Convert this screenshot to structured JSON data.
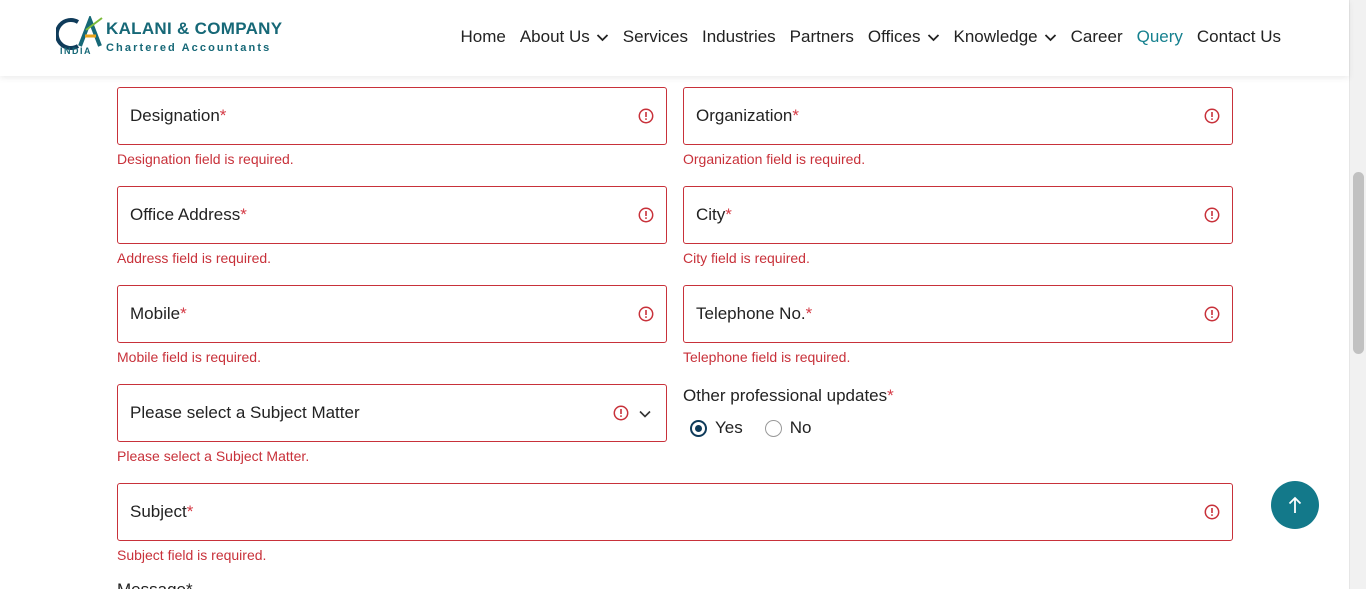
{
  "header": {
    "logo": {
      "name": "KALANI & COMPANY",
      "sub": "Chartered Accountants",
      "india": "INDIA",
      "mark": "CA"
    },
    "nav": [
      {
        "label": "Home"
      },
      {
        "label": "About Us"
      },
      {
        "label": "Services"
      },
      {
        "label": "Industries"
      },
      {
        "label": "Partners"
      },
      {
        "label": "Offices"
      },
      {
        "label": "Knowledge"
      },
      {
        "label": "Career"
      },
      {
        "label": "Query"
      },
      {
        "label": "Contact Us"
      }
    ],
    "active_nav": "Query"
  },
  "form": {
    "designation": {
      "label": "Designation",
      "required_mark": "*",
      "error": "Designation field is required."
    },
    "organization": {
      "label": "Organization",
      "required_mark": "*",
      "error": "Organization field is required."
    },
    "office_address": {
      "label": "Office Address",
      "required_mark": "*",
      "error": "Address field is required."
    },
    "city": {
      "label": "City",
      "required_mark": "*",
      "error": "City field is required."
    },
    "mobile": {
      "label": "Mobile",
      "required_mark": "*",
      "error": "Mobile field is required."
    },
    "telephone": {
      "label": "Telephone No.",
      "required_mark": "*",
      "error": "Telephone field is required."
    },
    "subject_matter": {
      "selected": "Please select a Subject Matter",
      "error": "Please select a Subject Matter."
    },
    "updates": {
      "label": "Other professional updates",
      "required_mark": "*",
      "options": [
        {
          "label": "Yes",
          "checked": true
        },
        {
          "label": "No",
          "checked": false
        }
      ]
    },
    "subject": {
      "label": "Subject",
      "required_mark": "*",
      "error": "Subject field is required."
    },
    "message_partial": "Message*"
  },
  "colors": {
    "brand": "#166877",
    "accent": "#16818f",
    "error": "#c8313a",
    "radio": "#0f3b5a",
    "to_top": "#13798a"
  },
  "icons": {
    "error": "exclamation-circle-icon",
    "dropdown": "chevron-down-icon",
    "to_top": "arrow-up-icon"
  }
}
